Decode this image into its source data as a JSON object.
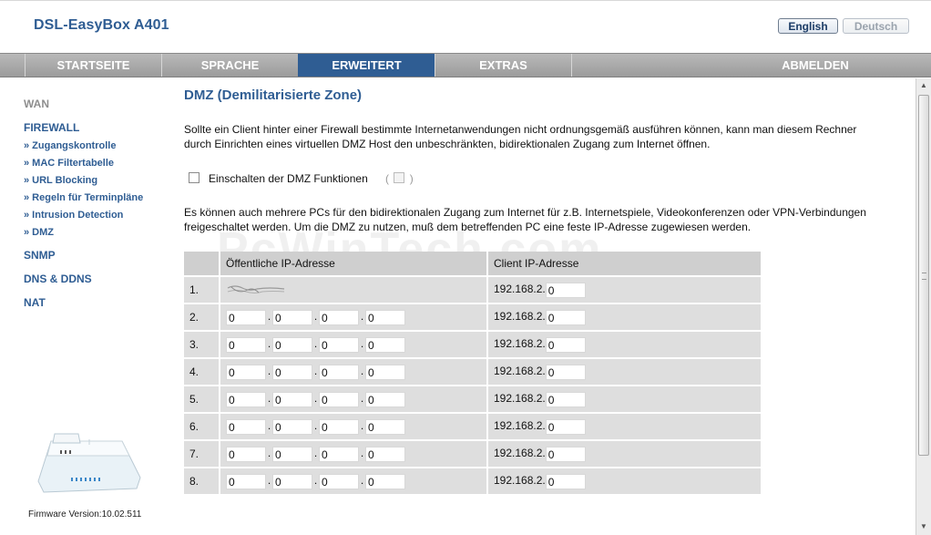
{
  "header": {
    "brand": "DSL-EasyBox A401",
    "lang_english": "English",
    "lang_deutsch": "Deutsch"
  },
  "nav": {
    "items": [
      {
        "label": "STARTSEITE"
      },
      {
        "label": "SPRACHE"
      },
      {
        "label": "ERWEITERT",
        "active": true
      },
      {
        "label": "EXTRAS"
      },
      {
        "label": "ABMELDEN"
      }
    ]
  },
  "sidebar": {
    "wan": "WAN",
    "firewall": "FIREWALL",
    "sub": [
      "» Zugangskontrolle",
      "» MAC Filtertabelle",
      "» URL Blocking",
      "» Regeln für Terminpläne",
      "» Intrusion Detection",
      "» DMZ"
    ],
    "snmp": "SNMP",
    "dns": "DNS & DDNS",
    "nat": "NAT",
    "firmware": "Firmware Version:10.02.511"
  },
  "main": {
    "title": "DMZ (Demilitarisierte Zone)",
    "intro": "Sollte ein Client hinter einer Firewall bestimmte Internetanwendungen nicht ordnungsgemäß ausführen können, kann man diesem Rechner durch Einrichten eines virtuellen DMZ Host den unbeschränkten, bidirektionalen Zugang zum Internet öffnen.",
    "enable_label": "Einschalten der DMZ Funktionen",
    "enable_checked": false,
    "paren_open": "(",
    "paren_close": ")",
    "info": "Es können auch mehrere PCs für den bidirektionalen Zugang zum Internet für z.B. Internetspiele, Videokonferenzen oder VPN-Verbindungen freigeschaltet werden. Um die DMZ zu nutzen, muß dem betreffenden PC eine feste IP-Adresse zugewiesen werden.",
    "watermark": "PcWinTech.com",
    "table": {
      "col_public": "Öffentliche IP-Adresse",
      "col_client": "Client IP-Adresse",
      "client_prefix": "192.168.2.",
      "rows": [
        {
          "num": "1.",
          "public": null,
          "client": "0"
        },
        {
          "num": "2.",
          "public": [
            "0",
            "0",
            "0",
            "0"
          ],
          "client": "0"
        },
        {
          "num": "3.",
          "public": [
            "0",
            "0",
            "0",
            "0"
          ],
          "client": "0"
        },
        {
          "num": "4.",
          "public": [
            "0",
            "0",
            "0",
            "0"
          ],
          "client": "0"
        },
        {
          "num": "5.",
          "public": [
            "0",
            "0",
            "0",
            "0"
          ],
          "client": "0"
        },
        {
          "num": "6.",
          "public": [
            "0",
            "0",
            "0",
            "0"
          ],
          "client": "0"
        },
        {
          "num": "7.",
          "public": [
            "0",
            "0",
            "0",
            "0"
          ],
          "client": "0"
        },
        {
          "num": "8.",
          "public": [
            "0",
            "0",
            "0",
            "0"
          ],
          "client": "0"
        }
      ]
    }
  },
  "colors": {
    "accent": "#2f5d93",
    "nav_bg": "#a8a8a8",
    "table_header": "#cfcfcf",
    "table_row": "#dedede"
  }
}
